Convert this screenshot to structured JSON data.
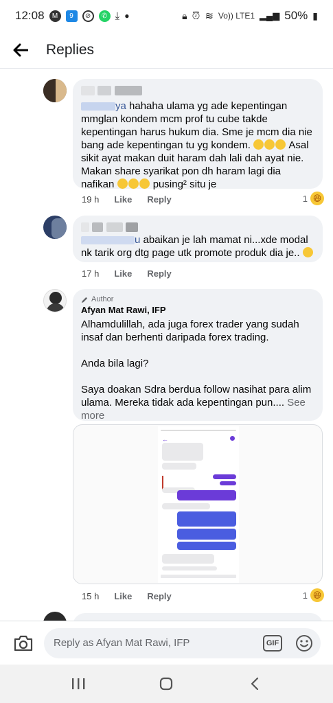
{
  "status_bar": {
    "time": "12:08",
    "network": "Vo)) LTE1",
    "battery": "50%"
  },
  "header": {
    "title": "Replies"
  },
  "comments": [
    {
      "name_partial": "ya",
      "text": "hahaha ulama yg ade kepentingan mmglan kondem mcm prof tu cube takde kepentingan harus hukum dia. Sme je mcm dia nie bang ade kepentingan tu yg kondem.",
      "text_2": " Asal sikit ayat makan duit haram dah lali dah ayat nie. Makan share syarikat pon dh haram lagi dia nafikan ",
      "text_3": " pusing² situ je",
      "time": "19 h",
      "like": "Like",
      "reply": "Reply",
      "reaction_count": "1"
    },
    {
      "name_partial": "u",
      "text": "abaikan je lah mamat ni...xde modal nk tarik org dtg page utk promote produk dia je..",
      "time": "17 h",
      "like": "Like",
      "reply": "Reply"
    },
    {
      "badge": "Author",
      "name": "Afyan Mat Rawi, IFP",
      "text": "Alhamdulillah, ada juga forex trader yang sudah insaf dan berhenti daripada forex trading.\n\nAnda bila lagi?\n\nSaya doakan Sdra berdua follow nasihat para alim ulama. Mereka tidak ada kepentingan pun.... ",
      "see_more": "See more",
      "time": "15 h",
      "like": "Like",
      "reply": "Reply",
      "reaction_count": "1"
    }
  ],
  "reply_bar": {
    "placeholder": "Reply as Afyan Mat Rawi, IFP",
    "gif_label": "GIF"
  },
  "colors": {
    "bubble": "#f0f2f5",
    "meta": "#65676b",
    "accent_purple": "#6b3bd8",
    "accent_blue": "#4a5de0"
  }
}
